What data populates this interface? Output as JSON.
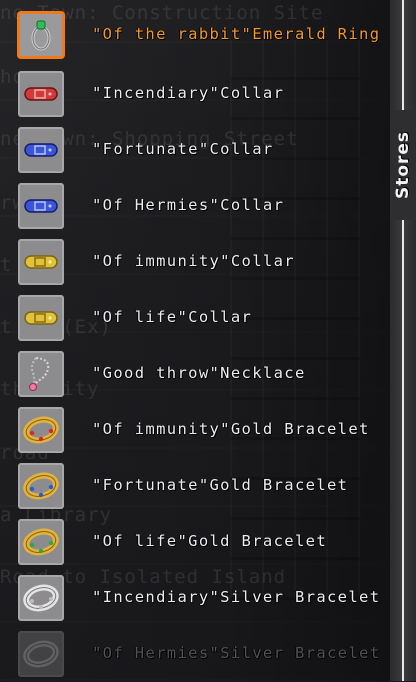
{
  "background_text": [
    "ne Town: Construction Site",
    "house",
    "ne Town: Shopping Street",
    "rway",
    "t ",
    "t          yer(Ex)",
    "the City",
    "road",
    "a Library",
    "Road to Isolated Island"
  ],
  "side_tab": {
    "label": "Stores"
  },
  "items": [
    {
      "name": "\"Of the rabbit\"Emerald Ring",
      "icon": "emerald-ring-icon",
      "state": "selected"
    },
    {
      "name": "\"Incendiary\"Collar",
      "icon": "red-collar-icon",
      "state": "normal"
    },
    {
      "name": "\"Fortunate\"Collar",
      "icon": "blue-collar-icon",
      "state": "normal"
    },
    {
      "name": "\"Of Hermies\"Collar",
      "icon": "blue-collar-icon",
      "state": "normal"
    },
    {
      "name": "\"Of immunity\"Collar",
      "icon": "gold-collar-icon",
      "state": "normal"
    },
    {
      "name": "\"Of life\"Collar",
      "icon": "gold-collar-icon",
      "state": "normal"
    },
    {
      "name": "\"Good throw\"Necklace",
      "icon": "chain-necklace-icon",
      "state": "normal"
    },
    {
      "name": "\"Of immunity\"Gold Bracelet",
      "icon": "gold-bracelet-red-gems-icon",
      "state": "normal"
    },
    {
      "name": "\"Fortunate\"Gold Bracelet",
      "icon": "gold-bracelet-blue-gems-icon",
      "state": "normal"
    },
    {
      "name": "\"Of life\"Gold Bracelet",
      "icon": "gold-bracelet-green-gems-icon",
      "state": "normal"
    },
    {
      "name": "\"Incendiary\"Silver Bracelet",
      "icon": "silver-bracelet-icon",
      "state": "normal"
    },
    {
      "name": "\"Of Hermies\"Silver Bracelet",
      "icon": "silver-bracelet-icon",
      "state": "faded"
    }
  ],
  "colors": {
    "selected_border": "#f07a1a",
    "selected_text": "#f39a2c",
    "normal_text": "#ededed"
  }
}
